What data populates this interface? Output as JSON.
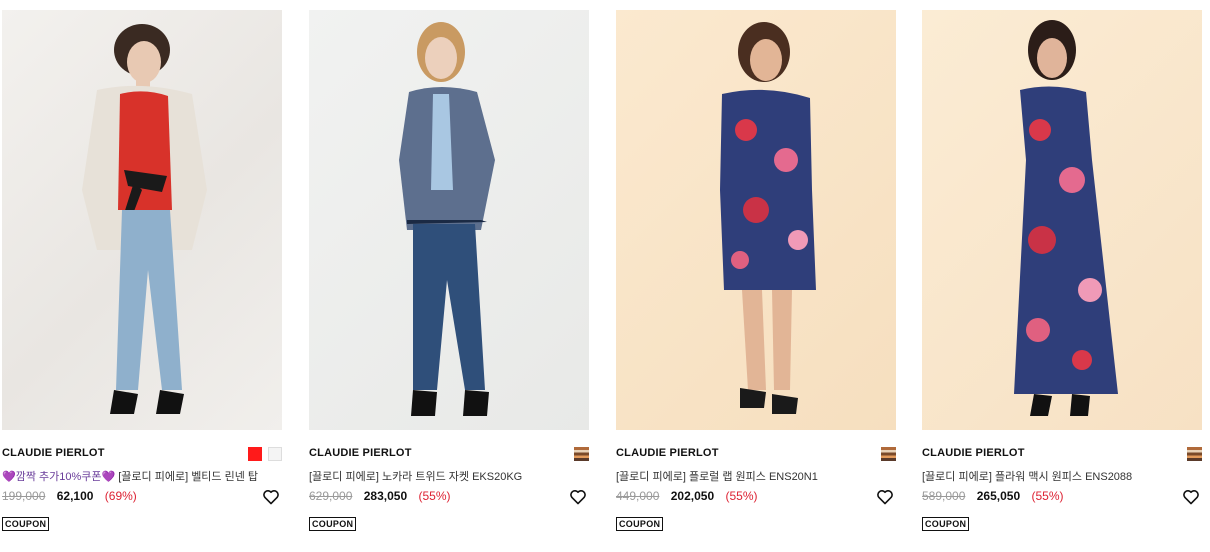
{
  "products": [
    {
      "brand": "CLAUDIE PIERLOT",
      "title_promo": "💜깜짝 추가10%쿠폰💜",
      "title": " [끌로디 피에로] 벨티드 린넨 탑",
      "original_price": "199,000",
      "sale_price": "62,100",
      "discount": "(69%)",
      "coupon": "COUPON",
      "swatches": [
        "#ff1a1a",
        "#f4f4f4"
      ]
    },
    {
      "brand": "CLAUDIE PIERLOT",
      "title_promo": "",
      "title": "[끌로디 피에로] 노카라 트위드 자켓 EKS20KG",
      "original_price": "629,000",
      "sale_price": "283,050",
      "discount": "(55%)",
      "coupon": "COUPON",
      "swatches": [
        "stripe"
      ]
    },
    {
      "brand": "CLAUDIE PIERLOT",
      "title_promo": "",
      "title": "[끌로디 피에로] 플로럴 랩 원피스 ENS20N1",
      "original_price": "449,000",
      "sale_price": "202,050",
      "discount": "(55%)",
      "coupon": "COUPON",
      "swatches": [
        "stripe"
      ]
    },
    {
      "brand": "CLAUDIE PIERLOT",
      "title_promo": "",
      "title": "[끌로디 피에로] 플라워 맥시 원피스 ENS2088",
      "original_price": "589,000",
      "sale_price": "265,050",
      "discount": "(55%)",
      "coupon": "COUPON",
      "swatches": [
        "stripe"
      ]
    }
  ]
}
